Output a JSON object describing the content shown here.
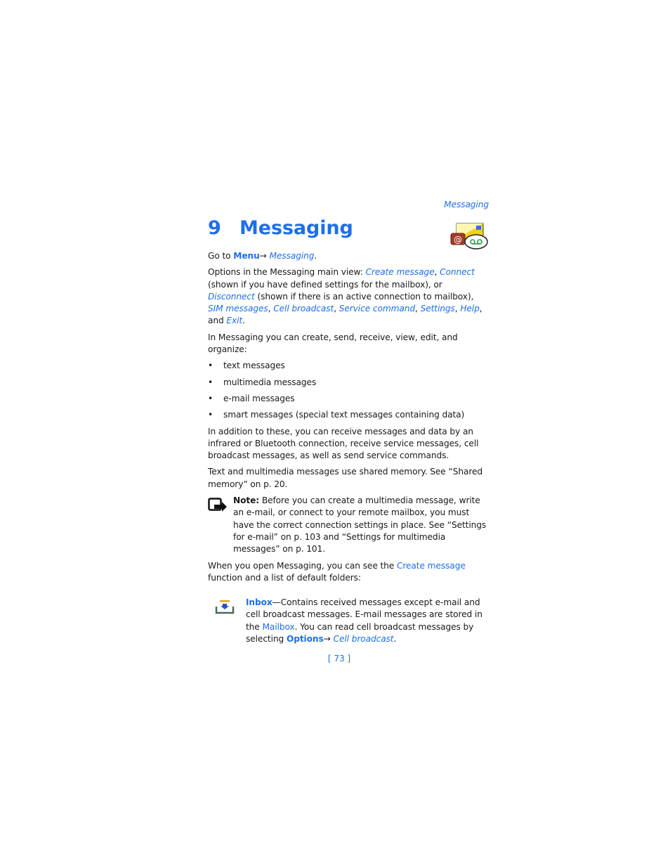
{
  "running_head": "Messaging",
  "chapter": {
    "number": "9",
    "title": "Messaging",
    "icon": "messaging-icon"
  },
  "goto": {
    "prefix": "Go to ",
    "menu": "Menu",
    "arrow": "→ ",
    "target": "Messaging",
    "suffix": "."
  },
  "options": {
    "intro": "Options in the Messaging main view: ",
    "create_message": "Create message",
    "sep1": ", ",
    "connect": "Connect",
    "connect_note": " (shown if you have defined settings for the mailbox), or ",
    "disconnect": "Disconnect",
    "disconnect_note": " (shown if there is an active connection to mailbox), ",
    "sim_messages": "SIM messages",
    "sep2": ", ",
    "cell_broadcast": "Cell broadcast",
    "sep3": ", ",
    "service_command": "Service command",
    "sep4": ", ",
    "settings": "Settings",
    "sep5": ", ",
    "help": "Help",
    "and": ", and ",
    "exit": "Exit",
    "end": "."
  },
  "intro_list": "In Messaging you can create, send, receive, view, edit, and organize:",
  "bullet_glyph": "•",
  "list_items": [
    "text messages",
    "multimedia messages",
    "e-mail messages",
    "smart messages (special text messages containing data)"
  ],
  "paragraph_additional": "In addition to these, you can receive messages and data by an infrared or Bluetooth connection, receive service messages, cell broadcast messages, as well as send service commands.",
  "paragraph_memory": "Text and multimedia messages use shared memory. See “Shared memory” on p. 20.",
  "note": {
    "icon": "note-icon",
    "label": "Note:",
    "text": " Before you can create a multimedia message, write an e-mail, or connect to your remote mailbox, you must have the correct connection settings in place. See “Settings for e-mail” on p. 103 and “Settings for multimedia messages” on p. 101."
  },
  "open_messaging": {
    "prefix": "When you open Messaging, you can see the ",
    "link": "Create message",
    "suffix": " function and a list of default folders:"
  },
  "inbox": {
    "icon": "inbox-icon",
    "label": "Inbox",
    "text1": "—Contains received messages except e-mail and cell broadcast messages. E-mail messages are stored in the ",
    "mailbox": "Mailbox",
    "text2": ". You can read cell broadcast messages by selecting ",
    "options": "Options",
    "arrow": "→ ",
    "cell_broadcast": "Cell broadcast",
    "end": "."
  },
  "page_number": "[ 73 ]",
  "colors": {
    "accent": "#1e6fe8",
    "text": "#1a1a1a"
  }
}
